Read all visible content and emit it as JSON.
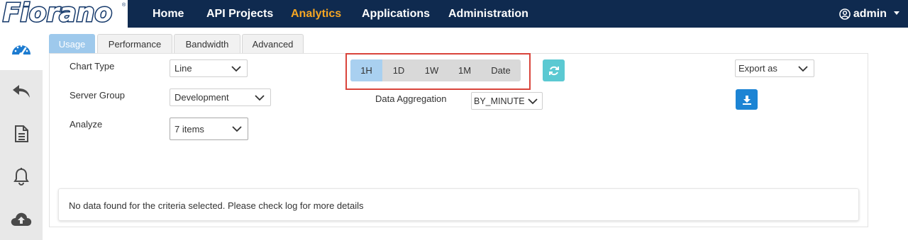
{
  "brand": {
    "name": "Fiorano",
    "trademark": "®"
  },
  "nav": {
    "items": [
      {
        "label": "Home"
      },
      {
        "label": "API Projects"
      },
      {
        "label": "Analytics"
      },
      {
        "label": "Applications"
      },
      {
        "label": "Administration"
      }
    ],
    "active_index": 2,
    "user": "admin"
  },
  "sidebar": {
    "items": [
      {
        "icon": "dashboard-gauge-icon"
      },
      {
        "icon": "undo-arrow-icon"
      },
      {
        "icon": "document-icon"
      },
      {
        "icon": "bell-icon"
      },
      {
        "icon": "cloud-upload-icon"
      }
    ],
    "active_index": 0
  },
  "tabs": [
    {
      "label": "Usage"
    },
    {
      "label": "Performance"
    },
    {
      "label": "Bandwidth"
    },
    {
      "label": "Advanced"
    }
  ],
  "form": {
    "chart_type": {
      "label": "Chart Type",
      "value": "Line"
    },
    "server_group": {
      "label": "Server Group",
      "value": "Development"
    },
    "analyze": {
      "label": "Analyze",
      "value": "7 items"
    },
    "data_aggregation": {
      "label": "Data Aggregation",
      "value": "BY_MINUTE"
    },
    "export": {
      "value": "Export as"
    }
  },
  "range": {
    "options": [
      "1H",
      "1D",
      "1W",
      "1M",
      "Date"
    ],
    "active": "1H"
  },
  "message": "No data found for the criteria selected. Please check log for more details",
  "colors": {
    "navbar": "#0f2a4f",
    "nav_active": "#f6a623",
    "tab_active": "#9ec9ec",
    "refresh": "#5bc9d2",
    "download": "#1c84d4",
    "highlight": "#d9443b"
  }
}
